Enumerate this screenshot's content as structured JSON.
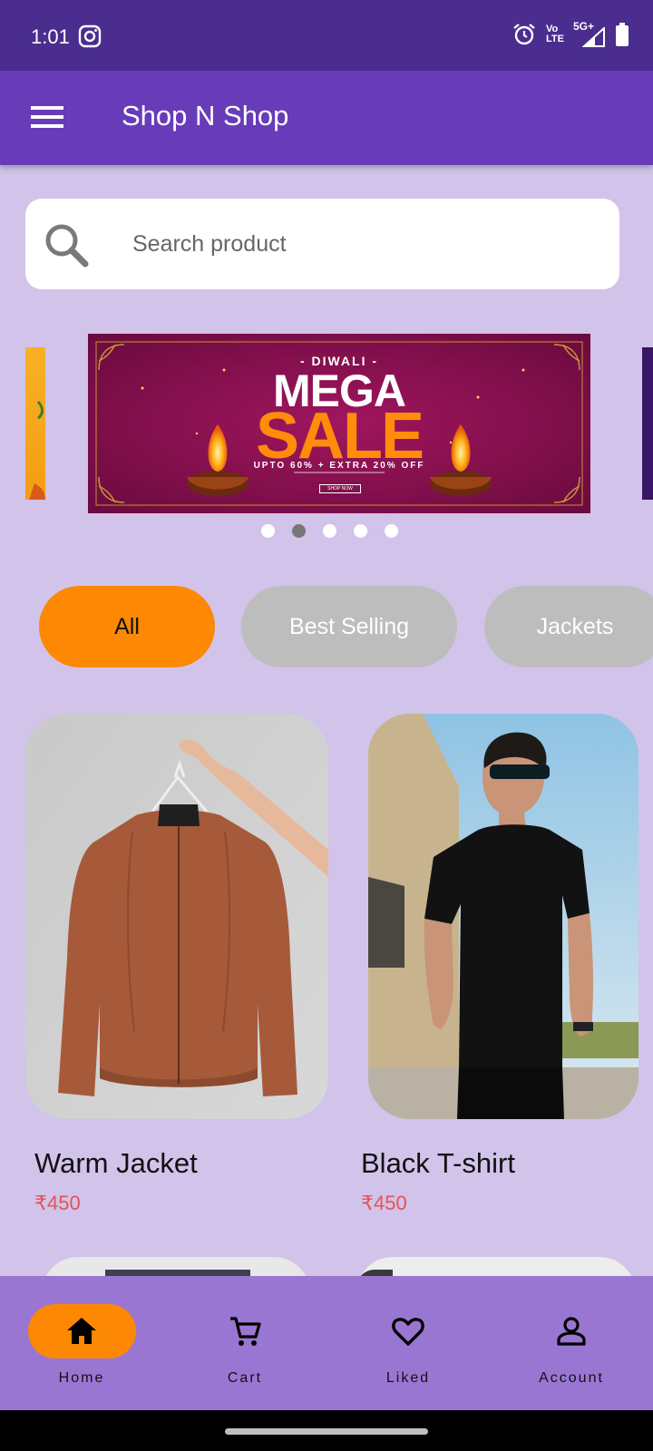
{
  "status_bar": {
    "time": "1:01",
    "icons": [
      "instagram-icon",
      "alarm-icon",
      "volte-icon",
      "signal-icon",
      "battery-icon"
    ],
    "volte_top": "Vo",
    "volte_bottom": "LTE",
    "network": "5G+"
  },
  "app_bar": {
    "title": "Shop N Shop",
    "menu_icon": "hamburger-menu-icon",
    "color": "#683cb8"
  },
  "search": {
    "placeholder": "Search product",
    "icon": "search-icon"
  },
  "carousel": {
    "banner": {
      "eyebrow": "- DIWALI -",
      "headline": "MEGA",
      "headline_accent": "SALE",
      "offer": "UPTO 60% + EXTRA 20% OFF",
      "cta": "SHOP NOW"
    },
    "dot_count": 5,
    "active_index": 1
  },
  "categories": {
    "items": [
      {
        "label": "All",
        "selected": true
      },
      {
        "label": "Best Selling",
        "selected": false
      },
      {
        "label": "Jackets",
        "selected": false
      }
    ],
    "selected_color": "#fc8803",
    "unselected_color": "#bdbdbd"
  },
  "products": [
    {
      "name": "Warm Jacket",
      "price": "₹450"
    },
    {
      "name": "Black T-shirt",
      "price": "₹450"
    }
  ],
  "bottom_nav": {
    "items": [
      {
        "label": "Home",
        "icon": "home-icon",
        "active": true
      },
      {
        "label": "Cart",
        "icon": "cart-icon",
        "active": false
      },
      {
        "label": "Liked",
        "icon": "heart-icon",
        "active": false
      },
      {
        "label": "Account",
        "icon": "account-icon",
        "active": false
      }
    ],
    "background": "#9a76d3",
    "active_color": "#fc8803"
  }
}
